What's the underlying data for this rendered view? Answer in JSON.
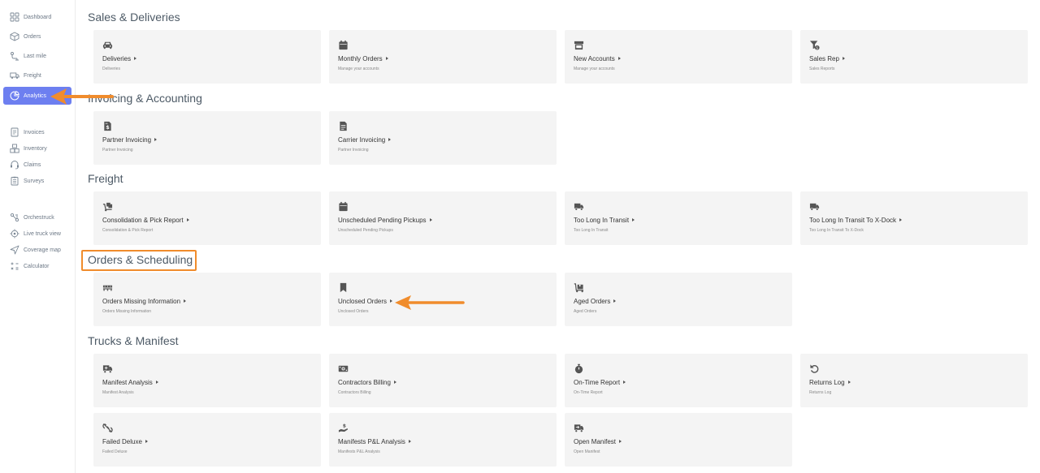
{
  "sidebar": {
    "items": [
      {
        "label": "Dashboard",
        "icon": "dashboard-icon"
      },
      {
        "label": "Orders",
        "icon": "box-icon"
      },
      {
        "label": "Last mile",
        "icon": "route-icon"
      },
      {
        "label": "Freight",
        "icon": "truck-icon"
      },
      {
        "label": "Analytics",
        "icon": "analytics-icon",
        "active": true
      },
      {
        "label": "Invoices",
        "icon": "invoice-icon"
      },
      {
        "label": "Inventory",
        "icon": "inventory-icon"
      },
      {
        "label": "Claims",
        "icon": "headset-icon"
      },
      {
        "label": "Surveys",
        "icon": "survey-icon"
      },
      {
        "label": "Orchestruck",
        "icon": "orchestrate-icon"
      },
      {
        "label": "Live truck view",
        "icon": "target-icon"
      },
      {
        "label": "Coverage map",
        "icon": "send-icon"
      },
      {
        "label": "Calculator",
        "icon": "calculator-icon"
      }
    ],
    "accent": "#6d7ff0"
  },
  "sections": [
    {
      "title": "Sales & Deliveries",
      "cards": [
        {
          "title": "Deliveries",
          "sub": "Deliveries",
          "icon": "car-icon"
        },
        {
          "title": "Monthly Orders",
          "sub": "Manage your accounts",
          "icon": "calendar-icon"
        },
        {
          "title": "New Accounts",
          "sub": "Manage your accounts",
          "icon": "store-icon"
        },
        {
          "title": "Sales Rep",
          "sub": "Sales Reports",
          "icon": "filter-dollar-icon"
        }
      ]
    },
    {
      "title": "Invoicing & Accounting",
      "cards": [
        {
          "title": "Partner Invoicing",
          "sub": "Partner Invoicing",
          "icon": "invoice-dollar-icon"
        },
        {
          "title": "Carrier Invoicing",
          "sub": "Partner Invoicing",
          "icon": "document-icon"
        }
      ]
    },
    {
      "title": "Freight",
      "cards": [
        {
          "title": "Consolidation & Pick Report",
          "sub": "Consolidation & Pick Report",
          "icon": "dolly-icon"
        },
        {
          "title": "Unscheduled Pending Pickups",
          "sub": "Unscheduled Pending Pickups",
          "icon": "calendar-icon"
        },
        {
          "title": "Too Long In Transit",
          "sub": "Too Long In Transit",
          "icon": "truck-fast-icon"
        },
        {
          "title": "Too Long In Transit To X-Dock",
          "sub": "Too Long In Transit To X-Dock",
          "icon": "truck-fast-icon"
        }
      ]
    },
    {
      "title": "Orders & Scheduling",
      "cards": [
        {
          "title": "Orders Missing Information",
          "sub": "Orders Missing Information",
          "icon": "pallet-icon"
        },
        {
          "title": "Unclosed Orders",
          "sub": "Unclosed Orders",
          "icon": "bookmark-icon"
        },
        {
          "title": "Aged Orders",
          "sub": "Aged Orders",
          "icon": "dolly-flatbed-icon"
        }
      ]
    },
    {
      "title": "Trucks & Manifest",
      "cards": [
        {
          "title": "Manifest Analysis",
          "sub": "Manifest Analysis",
          "icon": "truck-loading-icon"
        },
        {
          "title": "Contractors Billing",
          "sub": "Contractors Billing",
          "icon": "money-bill-icon"
        },
        {
          "title": "On-Time Report",
          "sub": "On-Time Report",
          "icon": "stopwatch-icon"
        },
        {
          "title": "Returns Log",
          "sub": "Returns Log",
          "icon": "undo-icon"
        },
        {
          "title": "Failed Deluxe",
          "sub": "Failed Deluxe",
          "icon": "unlink-icon"
        },
        {
          "title": "Manifests P&L Analysis",
          "sub": "Manifests P&L Analysis",
          "icon": "hand-dollar-icon"
        },
        {
          "title": "Open Manifest",
          "sub": "Open Manifest",
          "icon": "truck-moving-icon"
        }
      ]
    }
  ],
  "annotation_color": "#f08c2c"
}
